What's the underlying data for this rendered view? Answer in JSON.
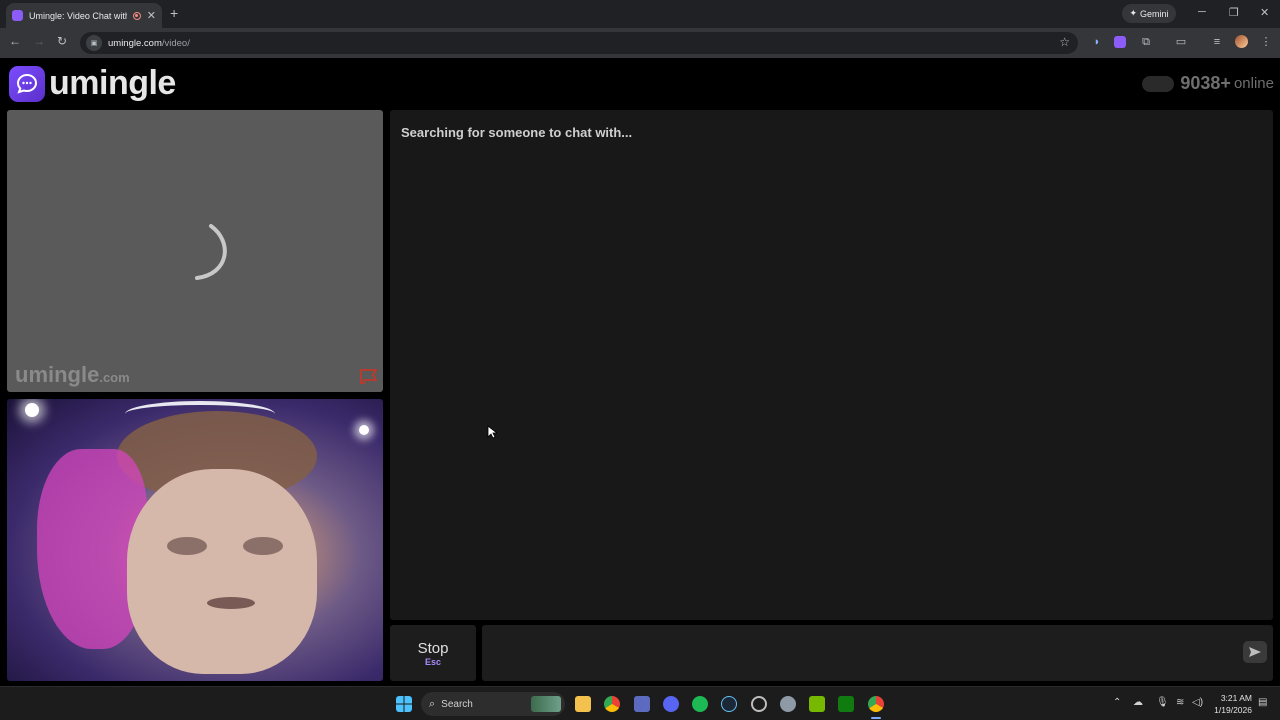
{
  "browser": {
    "tab_title": "Umingle: Video Chat with S",
    "tab_close": "✕",
    "new_tab": "+",
    "gemini_label": "Gemini",
    "url_host": "umingle.com",
    "url_path": "/video/",
    "window_controls": [
      "minimize",
      "restore",
      "close"
    ]
  },
  "site": {
    "logo_text": "umingle",
    "online_count": "9038+",
    "online_label": "online",
    "watermark_main": "umingle",
    "watermark_suffix": ".com"
  },
  "chat": {
    "status": "Searching for someone to chat with...",
    "stop_label": "Stop",
    "stop_key": "Esc",
    "message_value": ""
  },
  "taskbar": {
    "search_label": "Search",
    "time": "3:21 AM",
    "date": "1/19/2026",
    "apps": [
      "start-icon",
      "file-explorer-icon",
      "chrome-icon",
      "store-icon",
      "discord-icon",
      "spotify-icon",
      "steam-icon",
      "app-icon",
      "settings-icon",
      "nvidia-icon",
      "xbox-icon",
      "chrome-running-icon"
    ]
  },
  "colors": {
    "brand": "#7c4dff",
    "stop_key": "#a78bfa",
    "panel": "#181818"
  }
}
